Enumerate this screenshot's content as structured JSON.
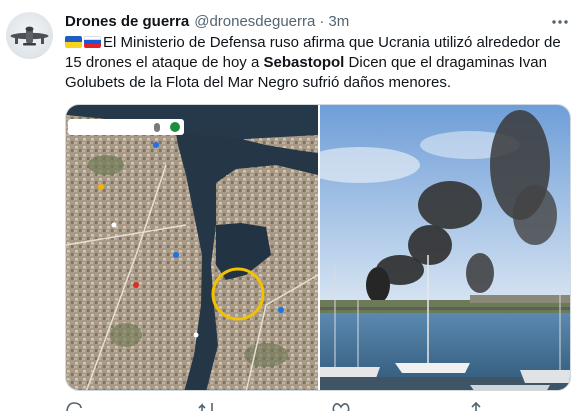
{
  "tweet": {
    "author_name": "Drones de guerra",
    "handle": "@dronesdeguerra",
    "separator": "·",
    "time": "3m",
    "text_main": "El Ministerio de Defensa ruso afirma que Ucrania utilizó alrededor de 15 drones el ataque de hoy a ",
    "text_bold": "Sebastopol",
    "text_tail": "  Dicen que el dragaminas Ivan Golubets de la Flota del Mar Negro sufrió daños menores."
  },
  "icons": {
    "avatar": "drone-avatar",
    "more": "more-options-icon",
    "flag_1": "ukraine-flag-icon",
    "flag_2": "russia-flag-icon",
    "reply": "reply-icon",
    "retweet": "retweet-icon",
    "like": "like-icon",
    "share": "share-icon"
  },
  "colors": {
    "text": "#0f1419",
    "secondary": "#536471",
    "border": "#cfd9de",
    "highlight_circle": "#f2c200"
  }
}
